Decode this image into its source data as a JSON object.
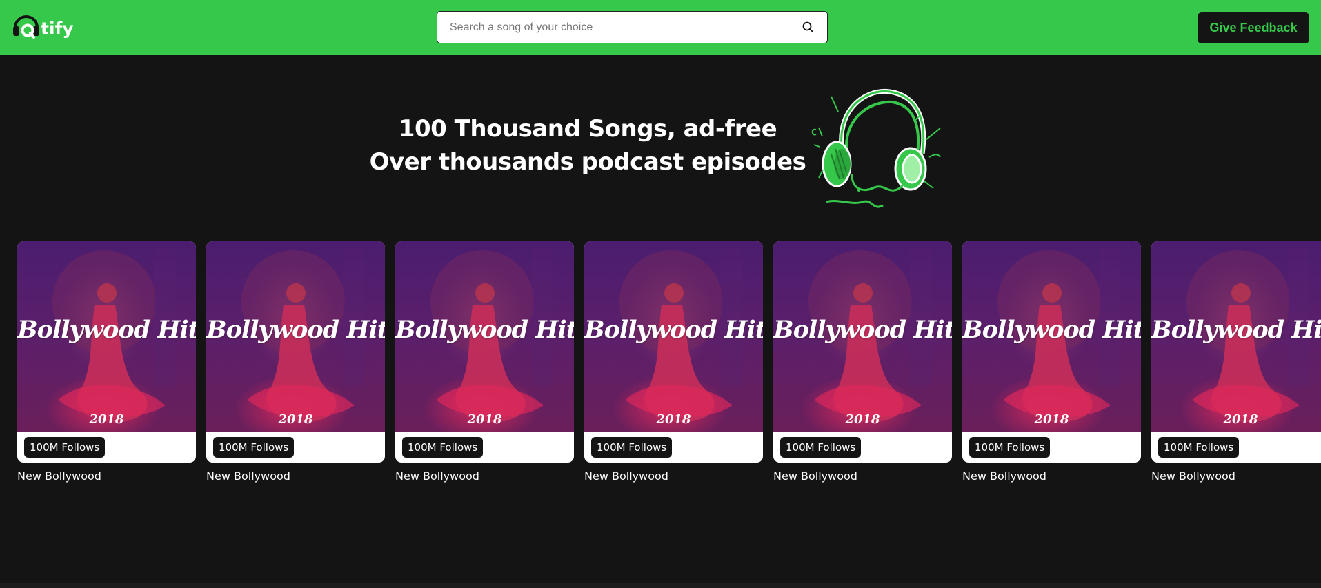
{
  "navbar": {
    "logo_text": "tify",
    "search_placeholder": "Search a song of your choice",
    "feedback_label": "Give Feedback"
  },
  "hero": {
    "line1": "100 Thousand Songs, ad-free",
    "line2": "Over thousands podcast episodes"
  },
  "cards": [
    {
      "art_title": "Bollywood Hits",
      "art_year": "2018",
      "follows": "100M Follows",
      "name": "New Bollywood"
    },
    {
      "art_title": "Bollywood Hits",
      "art_year": "2018",
      "follows": "100M Follows",
      "name": "New Bollywood"
    },
    {
      "art_title": "Bollywood Hits",
      "art_year": "2018",
      "follows": "100M Follows",
      "name": "New Bollywood"
    },
    {
      "art_title": "Bollywood Hits",
      "art_year": "2018",
      "follows": "100M Follows",
      "name": "New Bollywood"
    },
    {
      "art_title": "Bollywood Hits",
      "art_year": "2018",
      "follows": "100M Follows",
      "name": "New Bollywood"
    },
    {
      "art_title": "Bollywood Hits",
      "art_year": "2018",
      "follows": "100M Follows",
      "name": "New Bollywood"
    },
    {
      "art_title": "Bollywood Hits",
      "art_year": "2018",
      "follows": "100M Follows",
      "name": "New Bollywood"
    }
  ],
  "icons": {
    "logo": "headphones-icon",
    "search": "search-icon",
    "hero": "headphones-illustration"
  },
  "colors": {
    "brand_green": "#36c84a",
    "background": "#141414",
    "card_purple": "#4b1d6e",
    "card_pink": "#e0285a"
  }
}
